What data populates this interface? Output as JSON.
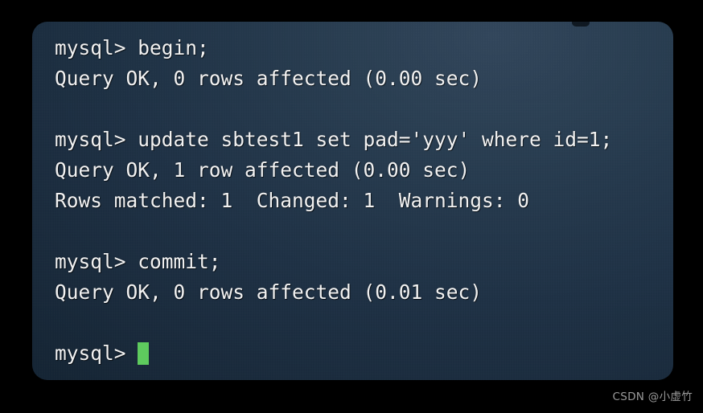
{
  "window": {
    "name": "mysql-terminal",
    "corner_radius_px": 19,
    "colors": {
      "page_background": "#000000",
      "terminal_background_light": "#32475c",
      "terminal_background_dark": "#132231",
      "text": "#f2f2f2",
      "cursor": "#5ecb5e",
      "watermark": "#9a9a9a"
    }
  },
  "terminal": {
    "prompt": "mysql>",
    "lines": [
      {
        "id": "line-1",
        "text": "mysql> begin;",
        "blank": false
      },
      {
        "id": "line-2",
        "text": "Query OK, 0 rows affected (0.00 sec)",
        "blank": false
      },
      {
        "id": "line-3",
        "text": "",
        "blank": true
      },
      {
        "id": "line-4",
        "text": "mysql> update sbtest1 set pad='yyy' where id=1;",
        "blank": false
      },
      {
        "id": "line-5",
        "text": "Query OK, 1 row affected (0.00 sec)",
        "blank": false
      },
      {
        "id": "line-6",
        "text": "Rows matched: 1  Changed: 1  Warnings: 0",
        "blank": false
      },
      {
        "id": "line-7",
        "text": "",
        "blank": true
      },
      {
        "id": "line-8",
        "text": "mysql> commit;",
        "blank": false
      },
      {
        "id": "line-9",
        "text": "Query OK, 0 rows affected (0.01 sec)",
        "blank": false
      },
      {
        "id": "line-10",
        "text": "",
        "blank": true
      }
    ],
    "cursor_line": {
      "prompt": "mysql>",
      "cursor_visible": true
    }
  },
  "watermark": {
    "text": "CSDN @小虚竹"
  }
}
